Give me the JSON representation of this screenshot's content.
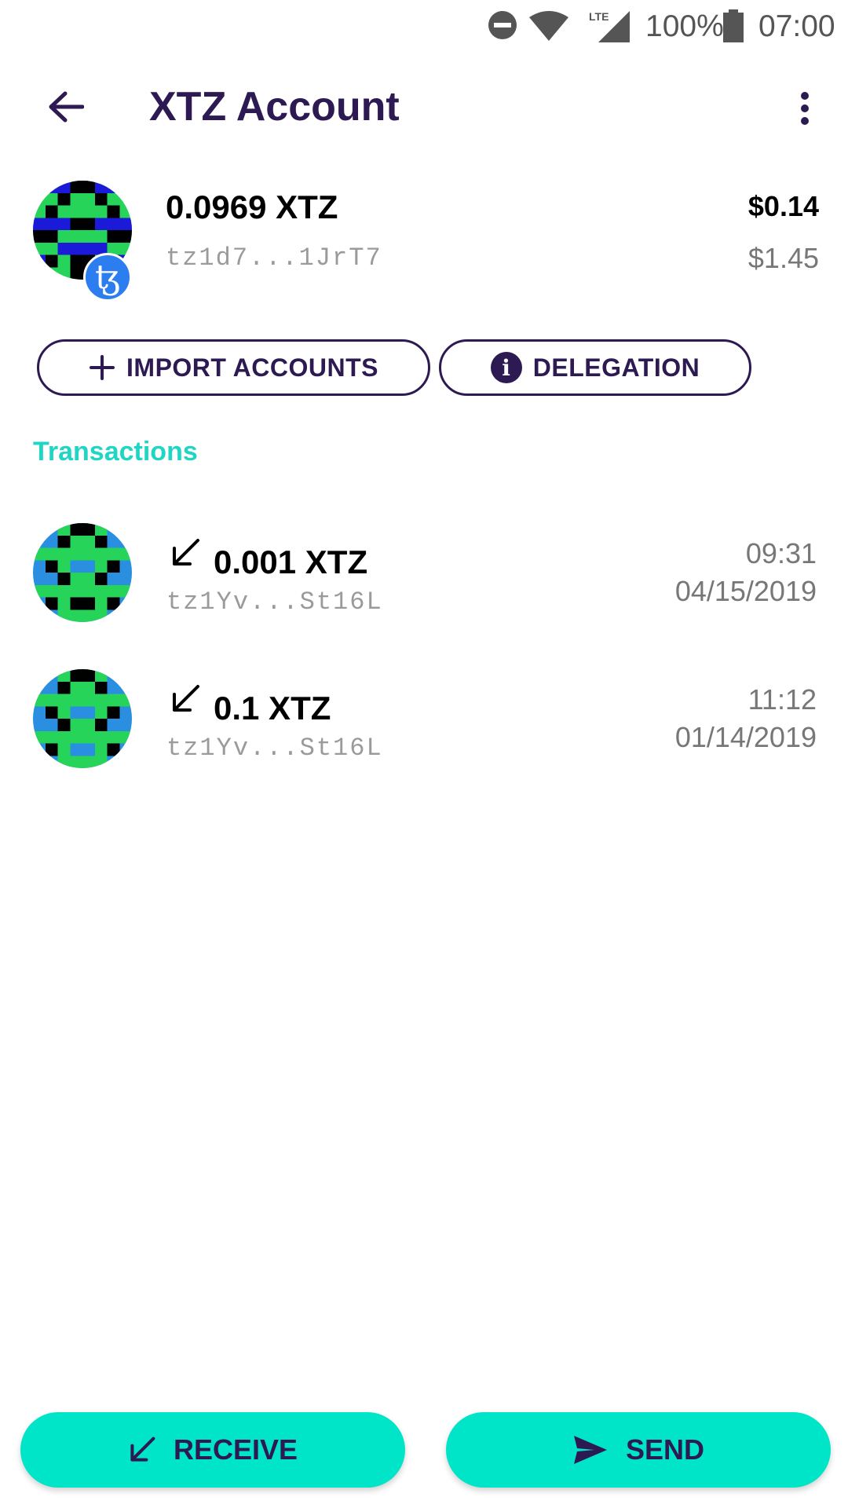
{
  "status_bar": {
    "battery_percent": "100%",
    "time": "07:00",
    "network": "LTE",
    "icons": [
      "do-not-disturb-icon",
      "wifi-icon",
      "lte-signal-icon",
      "battery-icon"
    ]
  },
  "header": {
    "title": "XTZ Account",
    "icons": [
      "back-arrow-icon",
      "more-vert-icon"
    ]
  },
  "account": {
    "balance": "0.0969 XTZ",
    "address": "tz1d7...1JrT7",
    "fiat_value": "$0.14",
    "fiat_sub": "$1.45",
    "badge_symbol": "ꜩ"
  },
  "actions": {
    "import_label": "IMPORT ACCOUNTS",
    "delegation_label": "DELEGATION",
    "info_glyph": "i"
  },
  "transactions": {
    "title": "Transactions",
    "items": [
      {
        "amount": "0.001 XTZ",
        "address": "tz1Yv...St16L",
        "time": "09:31",
        "date": "04/15/2019",
        "direction": "incoming"
      },
      {
        "amount": "0.1 XTZ",
        "address": "tz1Yv...St16L",
        "time": "11:12",
        "date": "01/14/2019",
        "direction": "incoming"
      }
    ]
  },
  "bottom": {
    "receive_label": "RECEIVE",
    "send_label": "SEND"
  },
  "colors": {
    "primary_dark": "#2e1a52",
    "accent_teal": "#00e5c8",
    "section_title": "#1fd6c4",
    "badge_blue": "#2c7df0"
  }
}
